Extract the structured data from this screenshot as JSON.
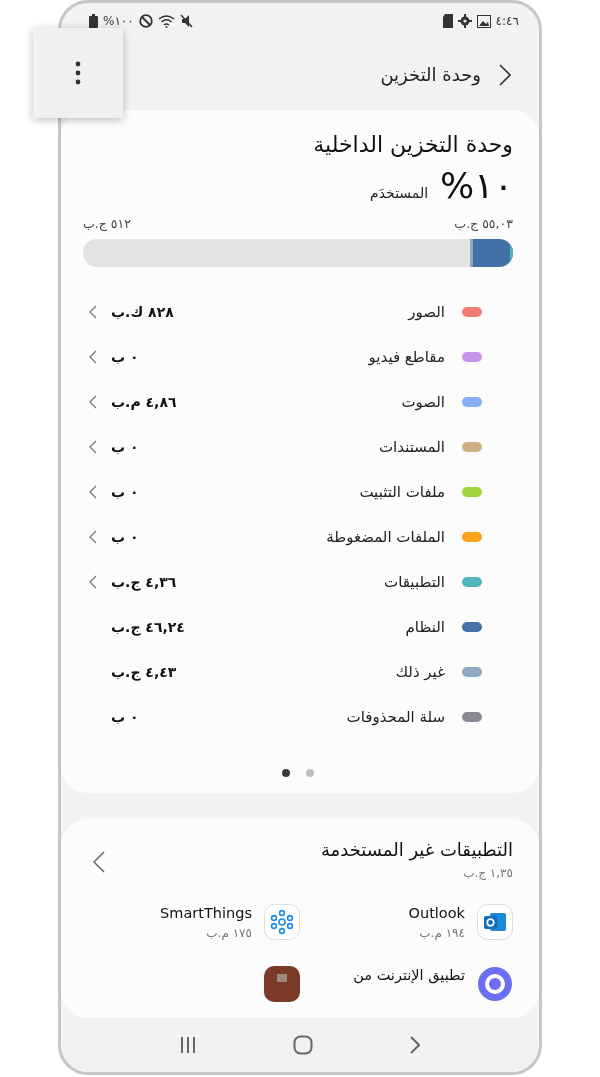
{
  "status_bar": {
    "battery": "%١٠٠",
    "time": "٤:٤٦"
  },
  "header": {
    "title": "وحدة التخزين"
  },
  "internal_storage": {
    "title": "وحدة التخزين الداخلية",
    "percent": "%١٠",
    "used_label": "المستخدَم",
    "used_amount": "٥٥,٠٣ ج.ب",
    "total": "٥١٢ ج.ب",
    "level": 0.1,
    "categories": [
      {
        "name": "الصور",
        "size": "٨٢٨ ك.ب",
        "color": "#f07b72",
        "chevron": true
      },
      {
        "name": "مقاطع فيديو",
        "size": "٠ ب",
        "color": "#c792ec",
        "chevron": true
      },
      {
        "name": "الصوت",
        "size": "٤,٨٦ م.ب",
        "color": "#86b0f5",
        "chevron": true
      },
      {
        "name": "المستندات",
        "size": "٠ ب",
        "color": "#cfae82",
        "chevron": true
      },
      {
        "name": "ملفات التثبيت",
        "size": "٠ ب",
        "color": "#a3d63c",
        "chevron": true
      },
      {
        "name": "الملفات المضغوطة",
        "size": "٠ ب",
        "color": "#fba21c",
        "chevron": true
      },
      {
        "name": "التطبيقات",
        "size": "٤,٣٦ ج.ب",
        "color": "#52b4bb",
        "chevron": true
      },
      {
        "name": "النظام",
        "size": "٤٦,٢٤ ج.ب",
        "color": "#4470a8",
        "chevron": false
      },
      {
        "name": "غير ذلك",
        "size": "٤,٤٣ ج.ب",
        "color": "#8ea9c0",
        "chevron": false
      },
      {
        "name": "سلة المحذوفات",
        "size": "٠ ب",
        "color": "#8a8a96",
        "chevron": false
      }
    ],
    "pages": [
      {
        "selected": true
      },
      {
        "selected": false
      }
    ]
  },
  "unused_apps": {
    "title": "التطبيقات غير المستخدمة",
    "size": "١,٣٥ ج.ب",
    "apps": [
      {
        "kind": "outlook",
        "name": "Outlook",
        "size": "١٩٤ م.ب"
      },
      {
        "kind": "smartthings",
        "name": "SmartThings",
        "size": "١٧٥ م.ب"
      },
      {
        "kind": "internet",
        "name": "تطبيق الإنترنت من"
      },
      {
        "kind": "brown"
      }
    ]
  }
}
